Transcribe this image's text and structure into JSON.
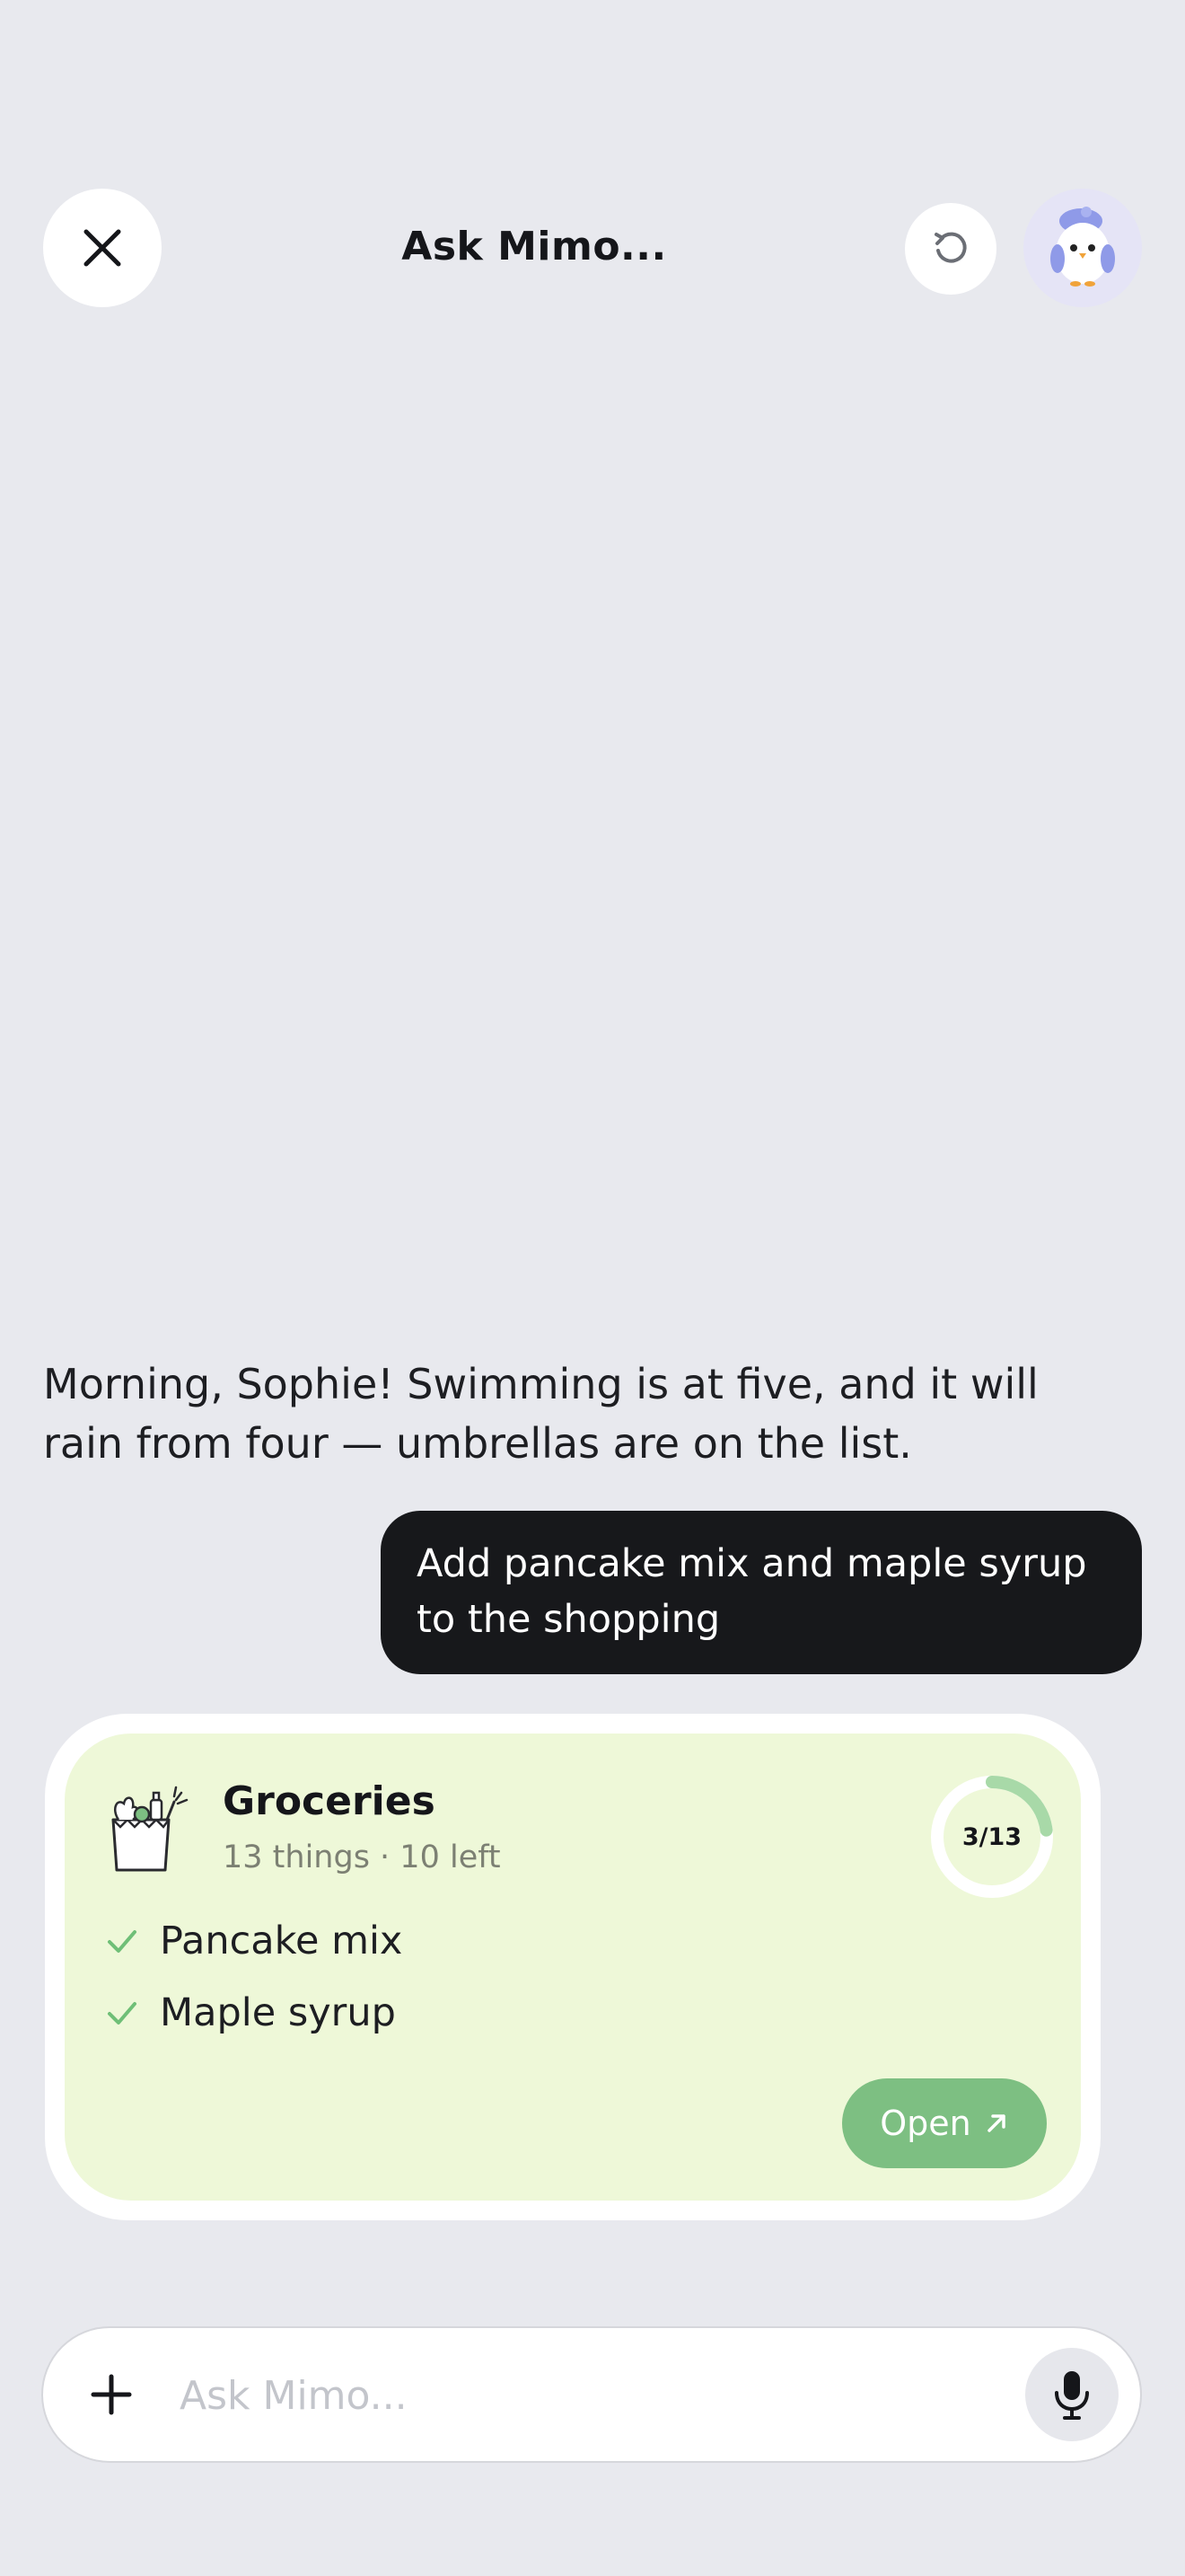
{
  "header": {
    "title": "Ask Mimo...",
    "close_icon": "close-icon",
    "reset_icon": "rotate-ccw-icon",
    "avatar": "bird-mascot-avatar"
  },
  "messages": {
    "assistant": "Morning, Sophie! Swimming is at five, and it will rain from four — umbrellas are on the list.",
    "user": "Add pancake mix and maple syrup to the shopping"
  },
  "card": {
    "icon": "grocery-bag-icon",
    "title": "Groceries",
    "subtitle": "13 things · 10 left",
    "progress_label": "3/13",
    "progress": {
      "done": 3,
      "total": 13
    },
    "items": [
      {
        "label": "Pancake mix",
        "checked": true
      },
      {
        "label": "Maple syrup",
        "checked": true
      }
    ],
    "open_label": "Open"
  },
  "composer": {
    "placeholder": "Ask Mimo...",
    "value": ""
  },
  "colors": {
    "background": "#e8e9ee",
    "card_bg": "#eef8d8",
    "accent_green": "#7dbf82",
    "user_bubble": "#17181b"
  }
}
